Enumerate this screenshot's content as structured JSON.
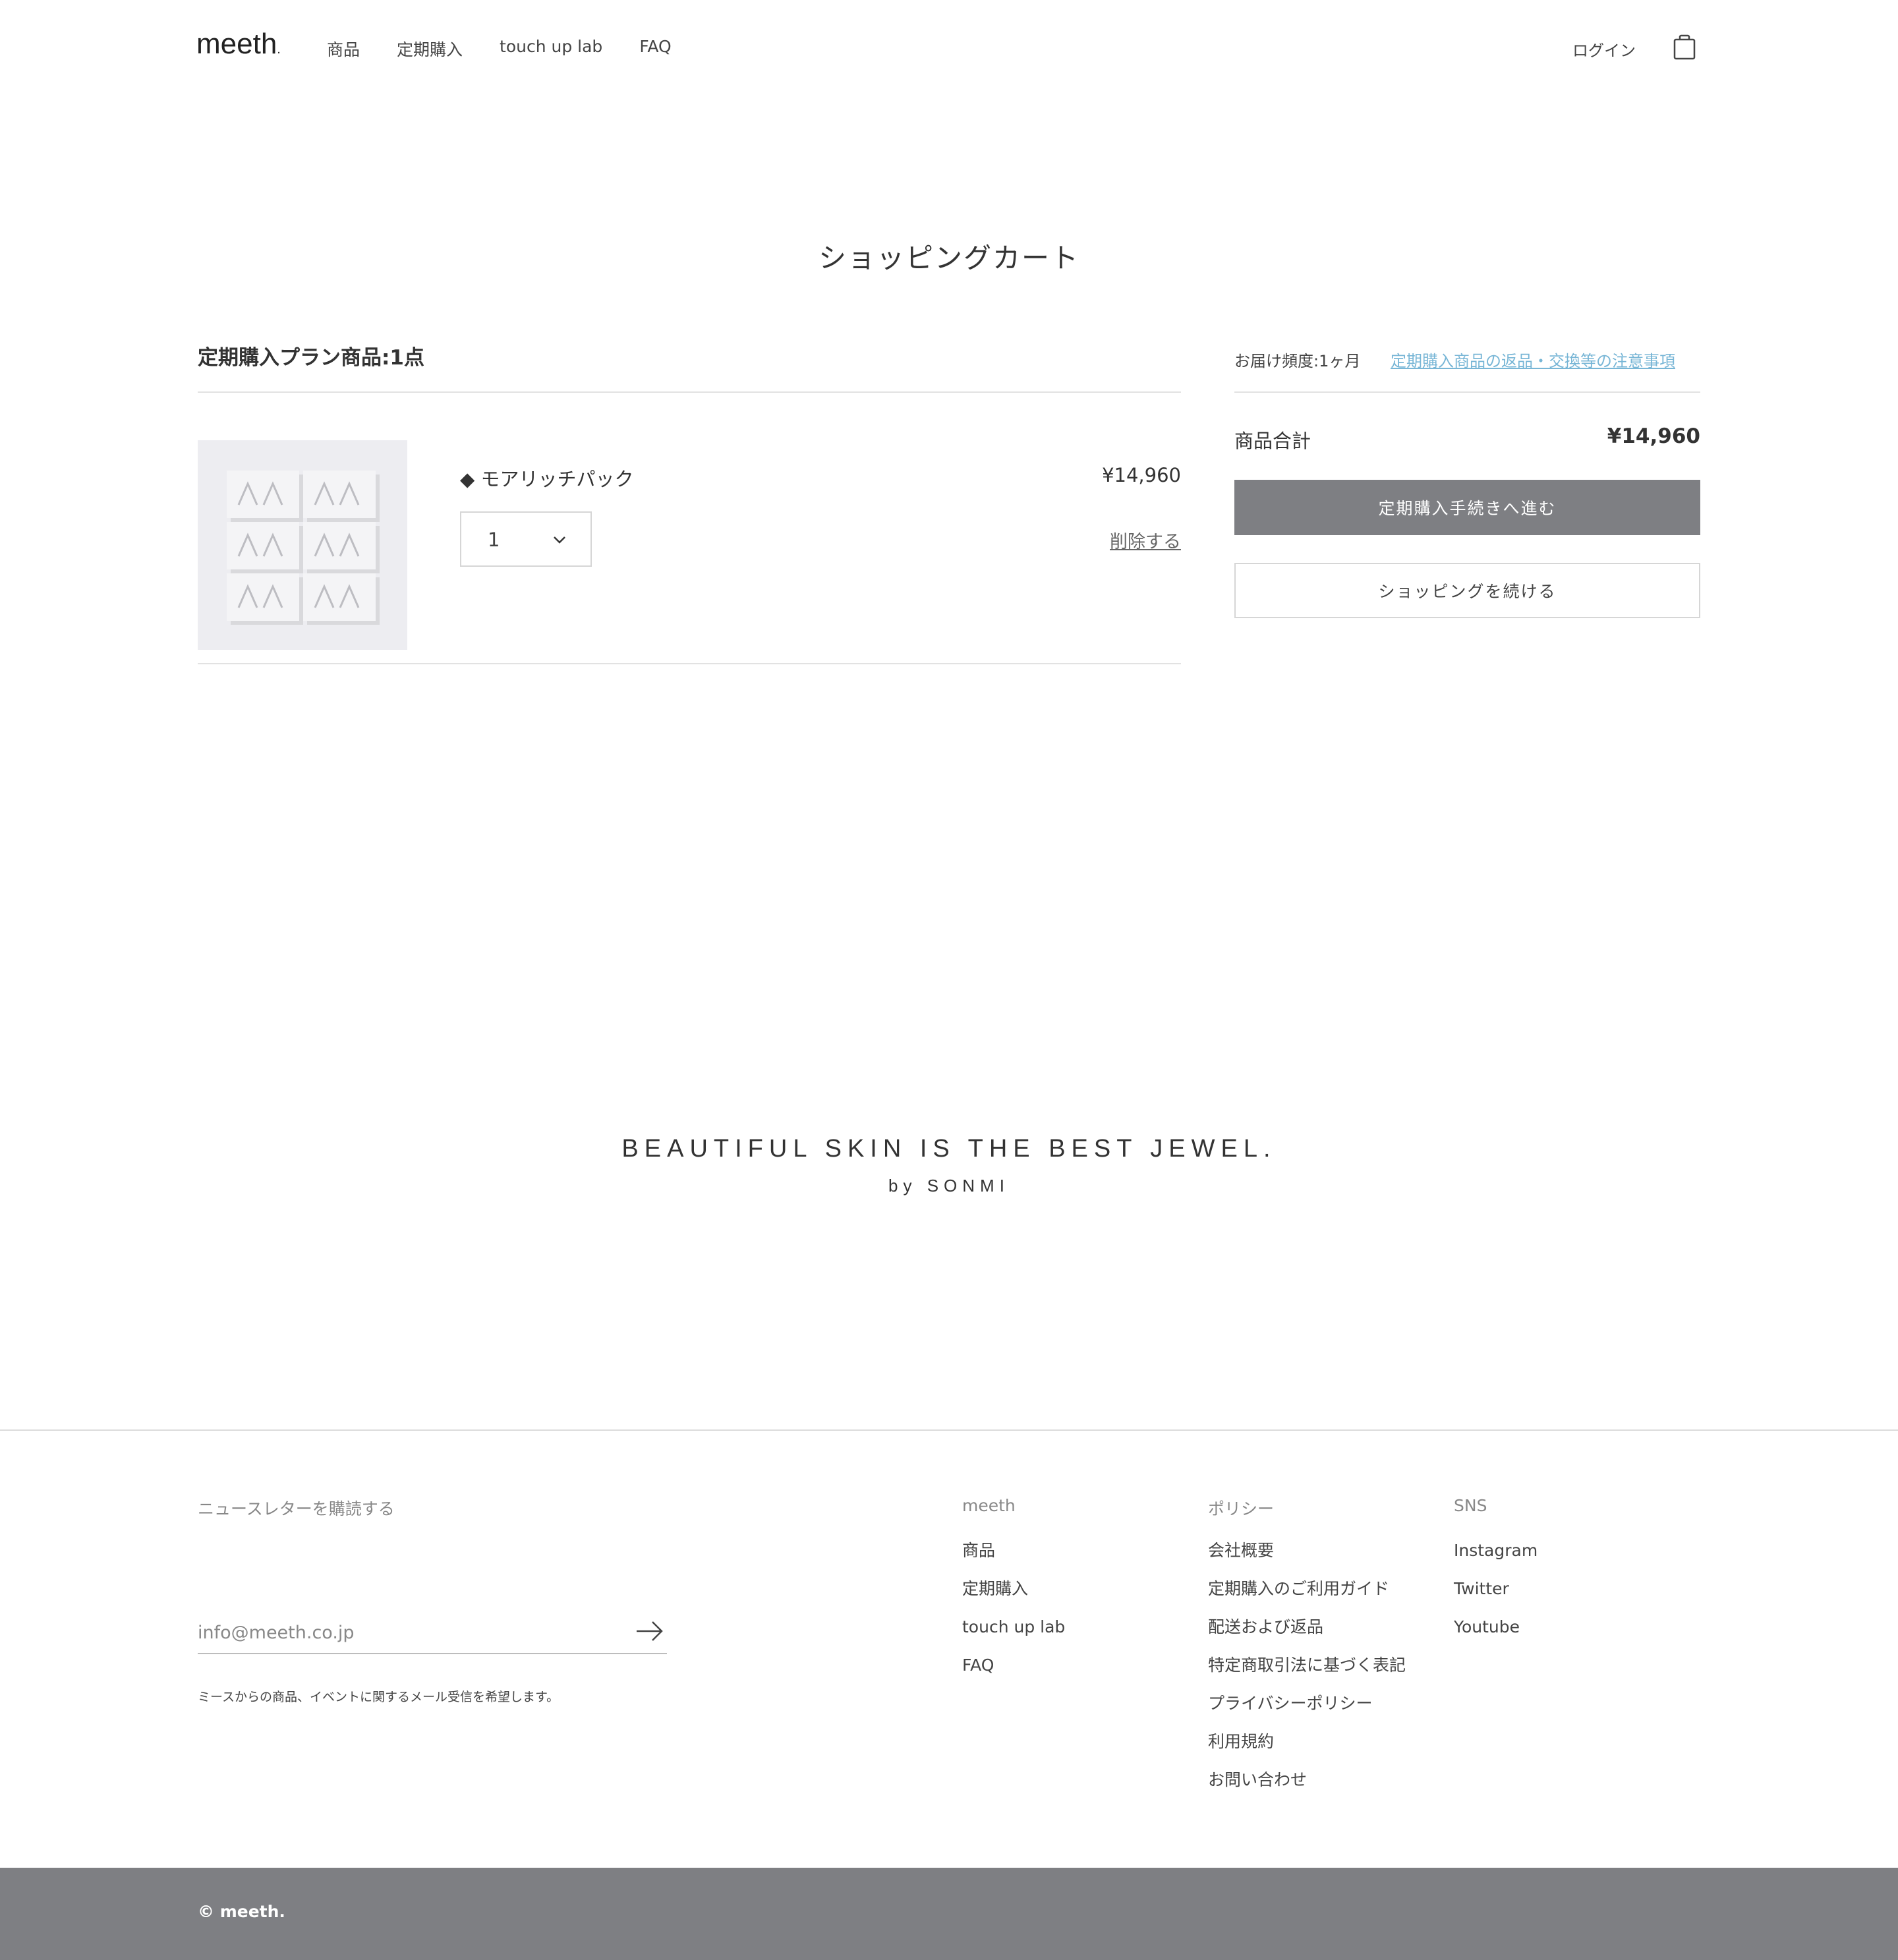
{
  "header": {
    "logo": "meeth",
    "logo_dot": ".",
    "nav": [
      "商品",
      "定期購入",
      "touch up lab",
      "FAQ"
    ],
    "login": "ログイン"
  },
  "page_title": "ショッピングカート",
  "cart": {
    "plan_heading": "定期購入プラン商品:1点",
    "item": {
      "name": "◆ モアリッチパック",
      "price": "¥14,960",
      "quantity": "1",
      "delete_label": "削除する"
    }
  },
  "summary": {
    "delivery_frequency": "お届け頻度:1ヶ月",
    "notice_link": "定期購入商品の返品・交換等の注意事項",
    "subtotal_label": "商品合計",
    "subtotal_value": "¥14,960",
    "checkout_button": "定期購入手続きへ進む",
    "continue_button": "ショッピングを続ける"
  },
  "tagline": {
    "main": "BEAUTIFUL SKIN IS THE BEST JEWEL.",
    "by": "by SONMI"
  },
  "footer": {
    "newsletter_title": "ニュースレターを購読する",
    "email_placeholder": "info@meeth.co.jp",
    "newsletter_note": "ミースからの商品、イベントに関するメール受信を希望します。",
    "columns": [
      {
        "title": "meeth",
        "items": [
          "商品",
          "定期購入",
          "touch up lab",
          "FAQ"
        ]
      },
      {
        "title": "ポリシー",
        "items": [
          "会社概要",
          "定期購入のご利用ガイド",
          "配送および返品",
          "特定商取引法に基づく表記",
          "プライバシーポリシー",
          "利用規約",
          "お問い合わせ"
        ]
      },
      {
        "title": "SNS",
        "items": [
          "Instagram",
          "Twitter",
          "Youtube"
        ]
      }
    ],
    "copyright": "© meeth."
  },
  "colors": {
    "accent_gray": "#7e7f83",
    "link_blue": "#78b6d6",
    "product_bg": "#ededf1"
  },
  "icons": {
    "cart": "shopping-bag-icon",
    "qty_dropdown": "chevron-down-icon",
    "submit": "arrow-right-icon"
  }
}
